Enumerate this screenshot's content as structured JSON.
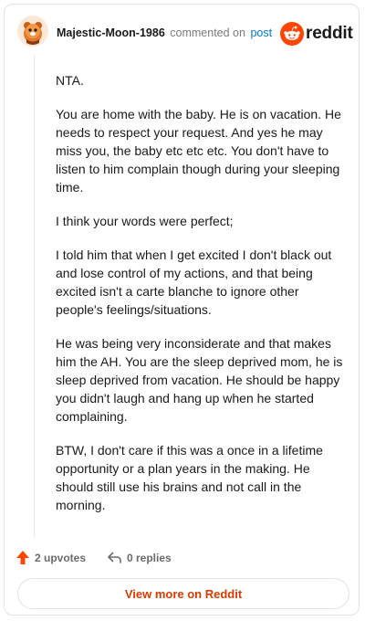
{
  "header": {
    "username": "Majestic-Moon-1986",
    "commented_text": "commented on",
    "post_link": "post",
    "brand": "reddit"
  },
  "comment": {
    "paragraphs": [
      "NTA.",
      "You are home with the baby. He is on vacation. He needs to respect your request. And yes he may miss you, the baby etc etc etc. You don't have to listen to him complain though during your sleeping time.",
      "I think your words were perfect;",
      "I told him that when I get excited I don't black out and lose control of my actions, and that being excited isn't a carte blanche to ignore other people's feelings/situations.",
      "He was being very inconsiderate and that makes him the AH. You are the sleep deprived mom, he is sleep deprived from vacation. He should be happy you didn't laugh and hang up when he started complaining.",
      "BTW, I don't care if this was a once in a lifetime opportunity or a plan years in the making. He should still use his brains and not call in the morning."
    ]
  },
  "actions": {
    "upvotes": "2 upvotes",
    "replies": "0 replies",
    "upvote_icon": "upvote-arrow-icon",
    "reply_icon": "reply-arrow-icon"
  },
  "footer": {
    "view_button": "View more on Reddit"
  },
  "colors": {
    "brand_orange": "#ff4500",
    "link_blue": "#0079d3",
    "button_text": "#d93a00"
  }
}
